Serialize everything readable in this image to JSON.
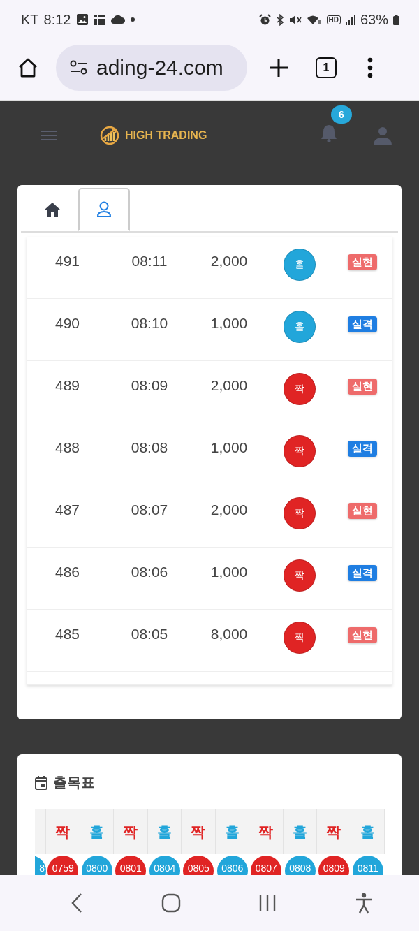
{
  "status_bar": {
    "carrier": "KT",
    "time": "8:12",
    "hd": "HD",
    "battery": "63%"
  },
  "browser": {
    "url": "ading-24.com",
    "tab_count": "1"
  },
  "header": {
    "brand": "HIGH TRADING",
    "notifications": "6"
  },
  "tabs": [
    {
      "kind": "home",
      "selected": false
    },
    {
      "kind": "user",
      "selected": true
    }
  ],
  "bets": [
    {
      "round": "491",
      "time": "08:11",
      "amount": "2,000",
      "pick": {
        "label": "홀",
        "color": "#22a6da"
      },
      "result": {
        "label": "실현",
        "color": "#ee6b6b"
      }
    },
    {
      "round": "490",
      "time": "08:10",
      "amount": "1,000",
      "pick": {
        "label": "홀",
        "color": "#22a6da"
      },
      "result": {
        "label": "실격",
        "color": "#1f7ee2"
      }
    },
    {
      "round": "489",
      "time": "08:09",
      "amount": "2,000",
      "pick": {
        "label": "짝",
        "color": "#e02424"
      },
      "result": {
        "label": "실현",
        "color": "#ee6b6b"
      }
    },
    {
      "round": "488",
      "time": "08:08",
      "amount": "1,000",
      "pick": {
        "label": "짝",
        "color": "#e02424"
      },
      "result": {
        "label": "실격",
        "color": "#1f7ee2"
      }
    },
    {
      "round": "487",
      "time": "08:07",
      "amount": "2,000",
      "pick": {
        "label": "짝",
        "color": "#e02424"
      },
      "result": {
        "label": "실현",
        "color": "#ee6b6b"
      }
    },
    {
      "round": "486",
      "time": "08:06",
      "amount": "1,000",
      "pick": {
        "label": "짝",
        "color": "#e02424"
      },
      "result": {
        "label": "실격",
        "color": "#1f7ee2"
      }
    },
    {
      "round": "485",
      "time": "08:05",
      "amount": "8,000",
      "pick": {
        "label": "짝",
        "color": "#e02424"
      },
      "result": {
        "label": "실현",
        "color": "#ee6b6b"
      }
    }
  ],
  "history": {
    "title": "출목표",
    "columns": [
      {
        "round": "8",
        "color": "#22a6da"
      },
      {
        "label": "짝",
        "round": "0759",
        "color": "#e02424"
      },
      {
        "label": "홀",
        "round": "0800",
        "color": "#22a6da"
      },
      {
        "label": "짝",
        "round": "0801",
        "color": "#e02424"
      },
      {
        "label": "홀",
        "round": "0804",
        "color": "#22a6da"
      },
      {
        "label": "짝",
        "round": "0805",
        "color": "#e02424"
      },
      {
        "label": "홀",
        "round": "0806",
        "color": "#22a6da"
      },
      {
        "label": "짝",
        "round": "0807",
        "color": "#e02424"
      },
      {
        "label": "홀",
        "round": "0808",
        "color": "#22a6da"
      },
      {
        "label": "짝",
        "round": "0809",
        "color": "#e02424"
      },
      {
        "label": "홀",
        "round": "0811",
        "color": "#22a6da"
      }
    ]
  }
}
